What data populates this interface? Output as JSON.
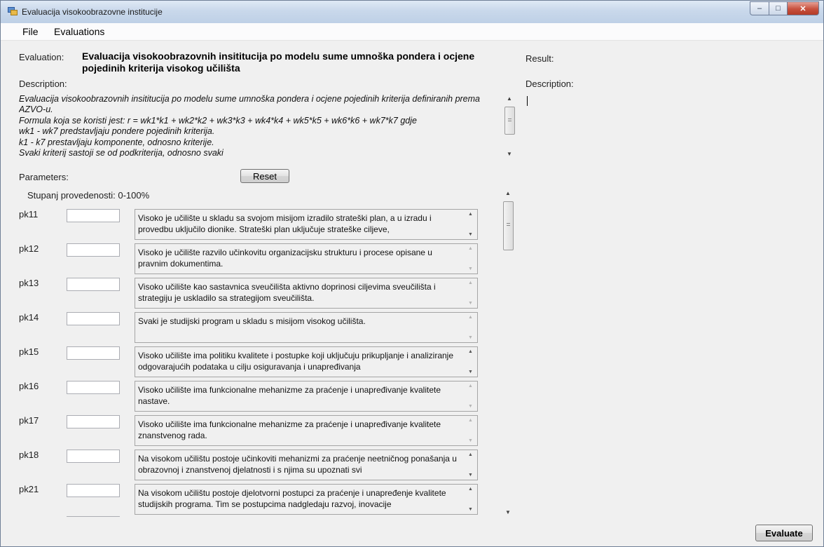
{
  "window": {
    "title": "Evaluacija visokoobrazovne institucije",
    "minimize_glyph": "–",
    "maximize_glyph": "□",
    "close_glyph": "✕",
    "icon": "app-window-icon"
  },
  "menu": {
    "file": "File",
    "evaluations": "Evaluations"
  },
  "evaluation": {
    "label": "Evaluation:",
    "title": "Evaluacija visokoobrazovnih insititucija po modelu sume umnoška pondera i ocjene pojedinih kriterija visokog učilišta",
    "description_label": "Description:",
    "description_lines": [
      "Evaluacija visokoobrazovnih insititucija po modelu sume umnoška pondera i ocjene pojedinih kriterija definiranih prema AZVO-u.",
      "Formula koja se koristi jest: r = wk1*k1 + wk2*k2 + wk3*k3 + wk4*k4 + wk5*k5 + wk6*k6 + wk7*k7 gdje",
      "wk1 - wk7 predstavljaju pondere pojedinih kriterija.",
      "k1 - k7 prestavljaju komponente, odnosno kriterije.",
      "Svaki kriterij sastoji se od podkriterija, odnosno svaki"
    ]
  },
  "parameters": {
    "label": "Parameters:",
    "reset_label": "Reset",
    "scale_hint": "Stupanj provedenosti: 0-100%",
    "items": [
      {
        "name": "pk11",
        "value": "",
        "description": "Visoko je učilište u skladu sa svojom misijom izradilo strateški plan, a u izradu i provedbu uključilo dionike. Strateški plan uključuje strateške ciljeve,",
        "scroll_enabled": true
      },
      {
        "name": "pk12",
        "value": "",
        "description": "Visoko je učilište razvilo učinkovitu organizacijsku strukturu i procese opisane u pravnim dokumentima.",
        "scroll_enabled": false
      },
      {
        "name": "pk13",
        "value": "",
        "description": "Visoko učilište kao sastavnica sveučilišta aktivno doprinosi ciljevima sveučilišta i strategiju je uskladilo sa strategijom sveučilišta.",
        "scroll_enabled": false
      },
      {
        "name": "pk14",
        "value": "",
        "description": "Svaki je studijski program u skladu s misijom visokog učilišta.",
        "scroll_enabled": false
      },
      {
        "name": "pk15",
        "value": "",
        "description": "Visoko učilište ima politiku kvalitete i postupke koji uključuju prikupljanje i analiziranje odgovarajućih podataka u cilju osiguravanja i unapređivanja",
        "scroll_enabled": true
      },
      {
        "name": "pk16",
        "value": "",
        "description": "Visoko učilište ima funkcionalne mehanizme za praćenje i unapređivanje kvalitete nastave.",
        "scroll_enabled": false
      },
      {
        "name": "pk17",
        "value": "",
        "description": "Visoko učilište ima funkcionalne mehanizme za praćenje i unapređivanje kvalitete znanstvenog rada.",
        "scroll_enabled": false
      },
      {
        "name": "pk18",
        "value": "",
        "description": "Na visokom učilištu postoje učinkoviti mehanizmi za praćenje neetničnog ponašanja u obrazovnoj i znanstvenoj djelatnosti i s njima su upoznati svi",
        "scroll_enabled": true
      },
      {
        "name": "pk21",
        "value": "",
        "description": "Na visokom učilištu postoje djelotvorni postupci za praćenje i unapređenje kvalitete studijskih programa. Tim se postupcima nadgledaju razvoj, inovacije",
        "scroll_enabled": true
      }
    ]
  },
  "result": {
    "label": "Result:",
    "description_label": "Description:",
    "value": ""
  },
  "actions": {
    "evaluate_label": "Evaluate"
  },
  "colors": {
    "title_gradient_top": "#dfe9f5",
    "close_button": "#c7503d",
    "window_bg": "#f0f0f0"
  }
}
